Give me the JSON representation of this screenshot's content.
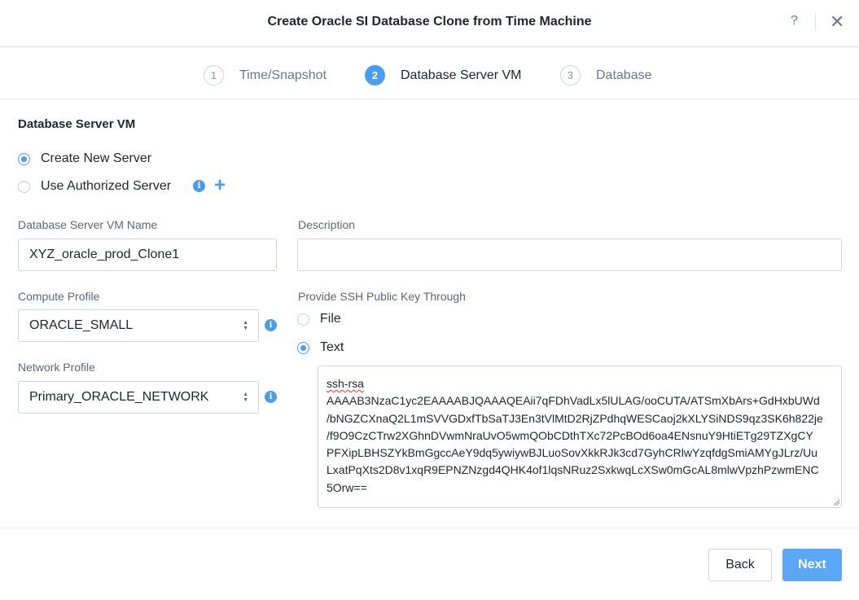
{
  "dialog": {
    "title": "Create Oracle SI Database Clone from Time Machine",
    "help_label": "?",
    "close_label": "✕"
  },
  "steps": [
    {
      "number": "1",
      "label": "Time/Snapshot",
      "active": false
    },
    {
      "number": "2",
      "label": "Database Server VM",
      "active": true
    },
    {
      "number": "3",
      "label": "Database",
      "active": false
    }
  ],
  "server_section": {
    "title": "Database Server VM",
    "options": [
      {
        "label": "Create New Server",
        "checked": true
      },
      {
        "label": "Use Authorized Server",
        "checked": false
      }
    ],
    "info_icon": "i"
  },
  "form": {
    "vm_name_label": "Database Server VM Name",
    "vm_name_value": "XYZ_oracle_prod_Clone1",
    "description_label": "Description",
    "description_value": "",
    "compute_profile_label": "Compute Profile",
    "compute_profile_value": "ORACLE_SMALL",
    "network_profile_label": "Network Profile",
    "network_profile_value": "Primary_ORACLE_NETWORK",
    "ssh_label": "Provide SSH Public Key Through",
    "ssh_options": [
      {
        "label": "File",
        "checked": false
      },
      {
        "label": "Text",
        "checked": true
      }
    ],
    "ssh_key_lines": [
      "ssh-rsa",
      "AAAAB3NzaC1yc2EAAAABJQAAAQEAii7qFDhVadLx5lULAG/ooCUTA/ATSmXbArs+GdHxbUWd",
      "/bNGZCXnaQ2L1mSVVGDxfTbSaTJ3En3tVlMtD2RjZPdhqWESCaoj2kXLYSiNDS9qz3SK6h822je",
      "/f9O9CzCTrw2XGhnDVwmNraUvO5wmQObCDthTXc72PcBOd6oa4ENsnuY9HtiETg29TZXgCY",
      "PFXipLBHSZYkBmGgccAeY9dq5ywiywBJLuoSovXkkRJk3cd7GyhCRlwYzqfdgSmiAMYgJLrz/Uu",
      "LxatPqXts2D8v1xqR9EPNZNzgd4QHK4of1lqsNRuz2SxkwqLcXSw0mGcAL8mlwVpzhPzwmENC",
      "5Orw=="
    ]
  },
  "footer": {
    "back_label": "Back",
    "next_label": "Next"
  },
  "colors": {
    "accent": "#4a9cf0",
    "primary_button": "#5aa8f5"
  }
}
